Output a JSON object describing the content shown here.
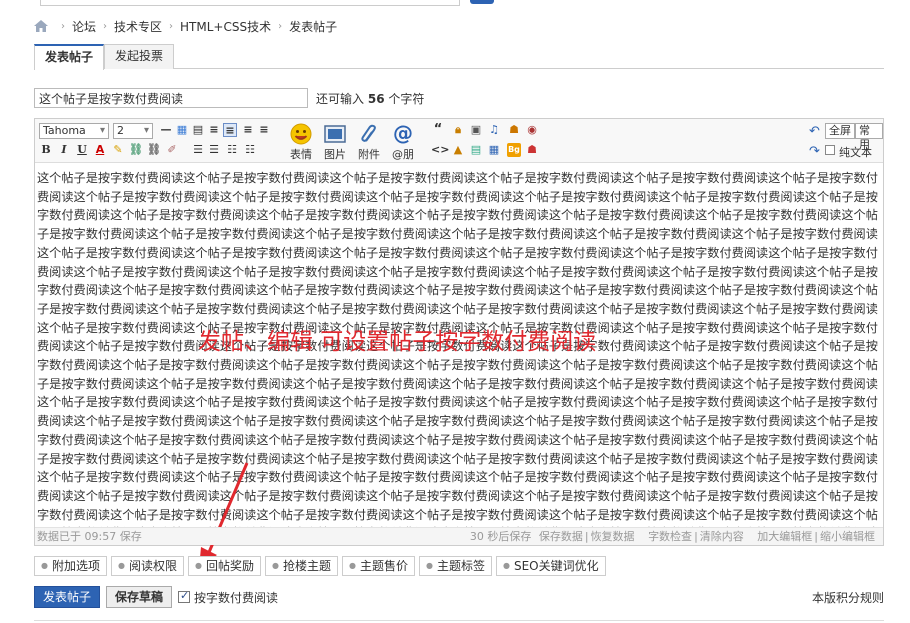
{
  "breadcrumb": {
    "items": [
      "论坛",
      "技术专区",
      "HTML+CSS技术",
      "发表帖子"
    ]
  },
  "tabs": {
    "post": "发表帖子",
    "poll": "发起投票"
  },
  "subject": {
    "value": "这个帖子是按字数付费阅读",
    "hint_prefix": "还可输入",
    "hint_count": "56",
    "hint_suffix": "个字符"
  },
  "toolbar": {
    "font": "Tahoma",
    "size": "2",
    "emoji_label": "表情",
    "image_label": "图片",
    "attach_label": "附件",
    "mention_label": "@朋",
    "fullscreen_label": "全屏",
    "common_label": "常用",
    "plaintext_label": "纯文本"
  },
  "content": {
    "text": "这个帖子是按字数付费阅读这个帖子是按字数付费阅读这个帖子是按字数付费阅读这个帖子是按字数付费阅读这个帖子是按字数付费阅读这个帖子是按字数付费阅读这个帖子是按字数付费阅读这个帖子是按字数付费阅读这个帖子是按字数付费阅读这个帖子是按字数付费阅读这个帖子是按字数付费阅读这个帖子是按字数付费阅读这个帖子是按字数付费阅读这个帖子是按字数付费阅读这个帖子是按字数付费阅读这个帖子是按字数付费阅读这个帖子是按字数付费阅读这个帖子是按字数付费阅读这个帖子是按字数付费阅读这个帖子是按字数付费阅读这个帖子是按字数付费阅读这个帖子是按字数付费阅读这个帖子是按字数付费阅读这个帖子是按字数付费阅读这个帖子是按字数付费阅读这个帖子是按字数付费阅读这个帖子是按字数付费阅读这个帖子是按字数付费阅读这个帖子是按字数付费阅读这个帖子是按字数付费阅读这个帖子是按字数付费阅读这个帖子是按字数付费阅读这个帖子是按字数付费阅读这个帖子是按字数付费阅读这个帖子是按字数付费阅读这个帖子是按字数付费阅读这个帖子是按字数付费阅读这个帖子是按字数付费阅读这个帖子是按字数付费阅读这个帖子是按字数付费阅读这个帖子是按字数付费阅读这个帖子是按字数付费阅读这个帖子是按字数付费阅读这个帖子是按字数付费阅读这个帖子是按字数付费阅读这个帖子是按字数付费阅读这个帖子是按字数付费阅读这个帖子是按字数付费阅读这个帖子是按字数付费阅读这个帖子是按字数付费阅读这个帖子是按字数付费阅读这个帖子是按字数付费阅读这个帖子是按字数付费阅读这个帖子是按字数付费阅读这个帖子是按字数付费阅读这个帖子是按字数付费阅读这个帖子是按字数付费阅读这个帖子是按字数付费阅读这个帖子是按字数付费阅读这个帖子是按字数付费阅读这个帖子是按字数付费阅读这个帖子是按字数付费阅读这个帖子是按字数付费阅读这个帖子是按字数付费阅读这个帖子是按字数付费阅读这个帖子是按字数付费阅读这个帖子是按字数付费阅读这个帖子是按字数付费阅读这个帖子是按字数付费阅读这个帖子是按字数付费阅读这个帖子是按字数付费阅读这个帖子是按字数付费阅读这个帖子是按字数付费阅读这个帖子是按字数付费阅读这个帖子是按字数付费阅读这个帖子是按字数付费阅读这个帖子是按字数付费阅读这个帖子是按字数付费阅读这个帖子是按字数付费阅读这个帖子是按字数付费阅读这个帖子是按字数付费阅读这个帖子是按字数付费阅读这个帖子是按字数付费阅读这个帖子是按字数付费阅读这个帖子是按字数付费阅读这个帖子是按字数付费阅读这个帖子是按字数付费阅读这个帖子是按字数付费阅读这个帖子是按字数付费阅读这个帖子是按字数付费阅读这个帖子是按字数付费阅读这个帖子是按字数付费阅读这个帖子是按字数付费阅读这个帖子是按字数付费阅读这个帖子是按字数付费阅读这个帖子是按字数付费阅读这个帖子是按字数付费阅读这个帖子是按字数付费阅读这个帖子是按字数付费阅读这个帖子是按字数付费阅读这个帖子是按字数付费阅读这个帖子是按字数付费阅读这个帖子是按字数付费阅读这个帖子是按字数付费阅读这个帖子是按字数付费阅读这个帖子是按字数付费阅读这个帖子是按字数付费阅读这个帖子是按字数付费阅读这个帖子是按字数付费阅读这个帖子是按字数付费阅读这个帖子是按字数付费阅读这个帖子是按字数付费阅读这个帖子是按字数付费阅读这个帖子是按字数付费阅读这个帖子是按字数付费阅读这个帖子是按字数付费阅读这个帖子是按字数付费阅读这个帖子是按字数付费阅读这个帖子是按字数付费阅读这个帖子是按字数付费阅读这个帖子是按字数付费阅读这个帖子是按字数付费阅读这个帖子是按字数付费阅读这个帖子是按字数付费阅读这个帖子是按字数付费阅读这个帖子是按字数付费阅读这个帖子是按字数付费阅读这个帖子是按字数付费阅读这个帖子是按字数付费阅读这个帖子是按字数付费阅读这个帖子是按字数付费阅读这个帖子是按字数付费阅读这个帖子是按字数付费阅读这个帖子是按字数付费阅读这个帖子是按字数付费阅读这个帖子是按字数付费阅读这个帖子是按字数付费阅读这个帖子是按字数付费阅读这个帖子是按字数付费阅读这个帖子是按字数付费阅读这个帖子是按字数付费阅读这个帖子是按字数付费阅读这个帖子是按字数付费阅读这个帖子是按字数付费阅读这个帖子是按字数付费阅读这个帖子是按字数付费阅读这个帖子是按字数付费阅读这个帖子是按字数付费阅读这个帖子是按字数付费阅读这个帖子是按字数付费阅读这个帖子是按字数付费阅读这个帖子是按字数付费阅读这个帖子是按字数付费阅读这个帖子是按字数付费阅读这个帖子是按字数付费阅读这个帖子是按字数付费阅读这个帖子是按字数付费阅读这个帖子是按字数付费阅读"
  },
  "annotation": "发帖、编辑 可设置帖子按字数付费阅读",
  "statusbar": {
    "saved": "数据已于 09:57 保存",
    "autosave": "30 秒后保存",
    "save_data": "保存数据",
    "restore_data": "恢复数据",
    "word_check": "字数检查",
    "clear": "清除内容",
    "enlarge": "加大编辑框",
    "shrink": "缩小编辑框"
  },
  "options": [
    "附加选项",
    "阅读权限",
    "回帖奖励",
    "抢楼主题",
    "主题售价",
    "主题标签",
    "SEO关键词优化"
  ],
  "actions": {
    "submit": "发表帖子",
    "draft": "保存草稿",
    "paid_read": "按字数付费阅读",
    "rules": "本版积分规则"
  },
  "colors": {
    "accent": "#2d63b3",
    "annotation": "#e0282e"
  }
}
